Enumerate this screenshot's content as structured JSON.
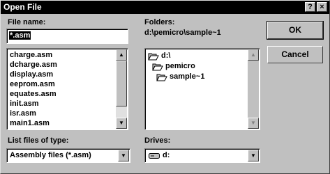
{
  "window": {
    "title": "Open File",
    "help_button": "?",
    "close_button": "×"
  },
  "filename": {
    "label": "File name:",
    "value": "*.asm",
    "files": [
      "charge.asm",
      "dcharge.asm",
      "display.asm",
      "eeprom.asm",
      "equates.asm",
      "init.asm",
      "isr.asm",
      "main1.asm"
    ]
  },
  "folders": {
    "label": "Folders:",
    "path": "d:\\pemicro\\sample~1",
    "items": [
      "d:\\",
      "pemicro",
      "sample~1"
    ]
  },
  "file_type": {
    "label": "List files of type:",
    "value": "Assembly files (*.asm)"
  },
  "drives": {
    "label": "Drives:",
    "value": "d:"
  },
  "buttons": {
    "ok": "OK",
    "cancel": "Cancel"
  },
  "icons": [
    "open-folder-icon",
    "drive-icon",
    "scroll-up-arrow",
    "scroll-down-arrow",
    "dropdown-arrow"
  ]
}
